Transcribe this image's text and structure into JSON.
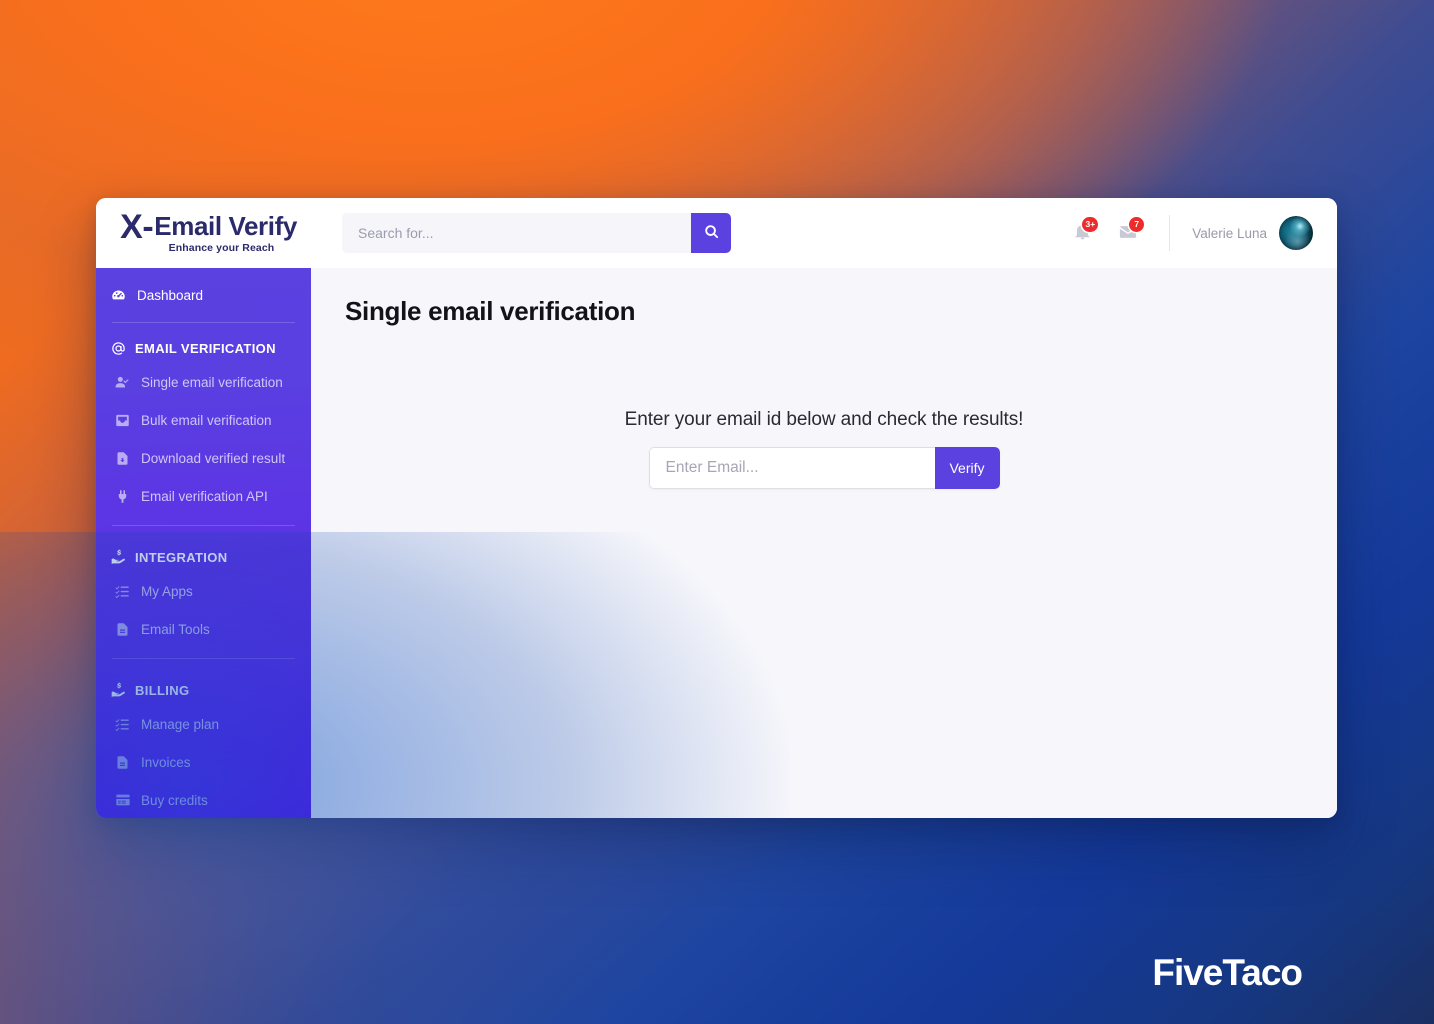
{
  "brand": {
    "mark": "X-",
    "name": "Email Verify",
    "tagline": "Enhance your Reach"
  },
  "search": {
    "placeholder": "Search for...",
    "value": "",
    "icon": "search-icon"
  },
  "header": {
    "notifications": {
      "icon": "bell-icon",
      "badge": "3+"
    },
    "messages": {
      "icon": "envelope-icon",
      "badge": "7"
    },
    "user": {
      "name": "Valerie Luna",
      "avatar": "user-avatar"
    }
  },
  "sidebar": {
    "dashboard": {
      "label": "Dashboard",
      "icon": "gauge-icon",
      "active": true
    },
    "sections": [
      {
        "title": "EMAIL VERIFICATION",
        "icon": "at-sign-icon",
        "items": [
          {
            "label": "Single email verification",
            "icon": "user-check-icon"
          },
          {
            "label": "Bulk email verification",
            "icon": "inbox-icon"
          },
          {
            "label": "Download verified result",
            "icon": "file-download-icon"
          },
          {
            "label": "Email verification API",
            "icon": "plug-icon"
          }
        ]
      },
      {
        "title": "INTEGRATION",
        "icon": "hand-holding-dollar-icon",
        "items": [
          {
            "label": "My Apps",
            "icon": "list-check-icon"
          },
          {
            "label": "Email Tools",
            "icon": "file-lines-icon"
          }
        ]
      },
      {
        "title": "BILLING",
        "icon": "hand-holding-dollar-icon",
        "items": [
          {
            "label": "Manage plan",
            "icon": "list-check-icon"
          },
          {
            "label": "Invoices",
            "icon": "file-lines-icon"
          },
          {
            "label": "Buy credits",
            "icon": "credit-card-icon"
          }
        ]
      }
    ]
  },
  "main": {
    "page_title": "Single email verification",
    "prompt": "Enter your email id below and check the results!",
    "email_placeholder": "Enter Email...",
    "email_value": "",
    "verify_label": "Verify"
  },
  "watermark": {
    "text": "FiveTaco"
  },
  "colors": {
    "accent": "#5B41E0",
    "sidebar_top": "#5B41E0",
    "sidebar_bottom": "#5D08EC",
    "badge": "#EE2B2B",
    "brand_navy": "#2B2A6B",
    "canvas": "#F7F7FB"
  }
}
